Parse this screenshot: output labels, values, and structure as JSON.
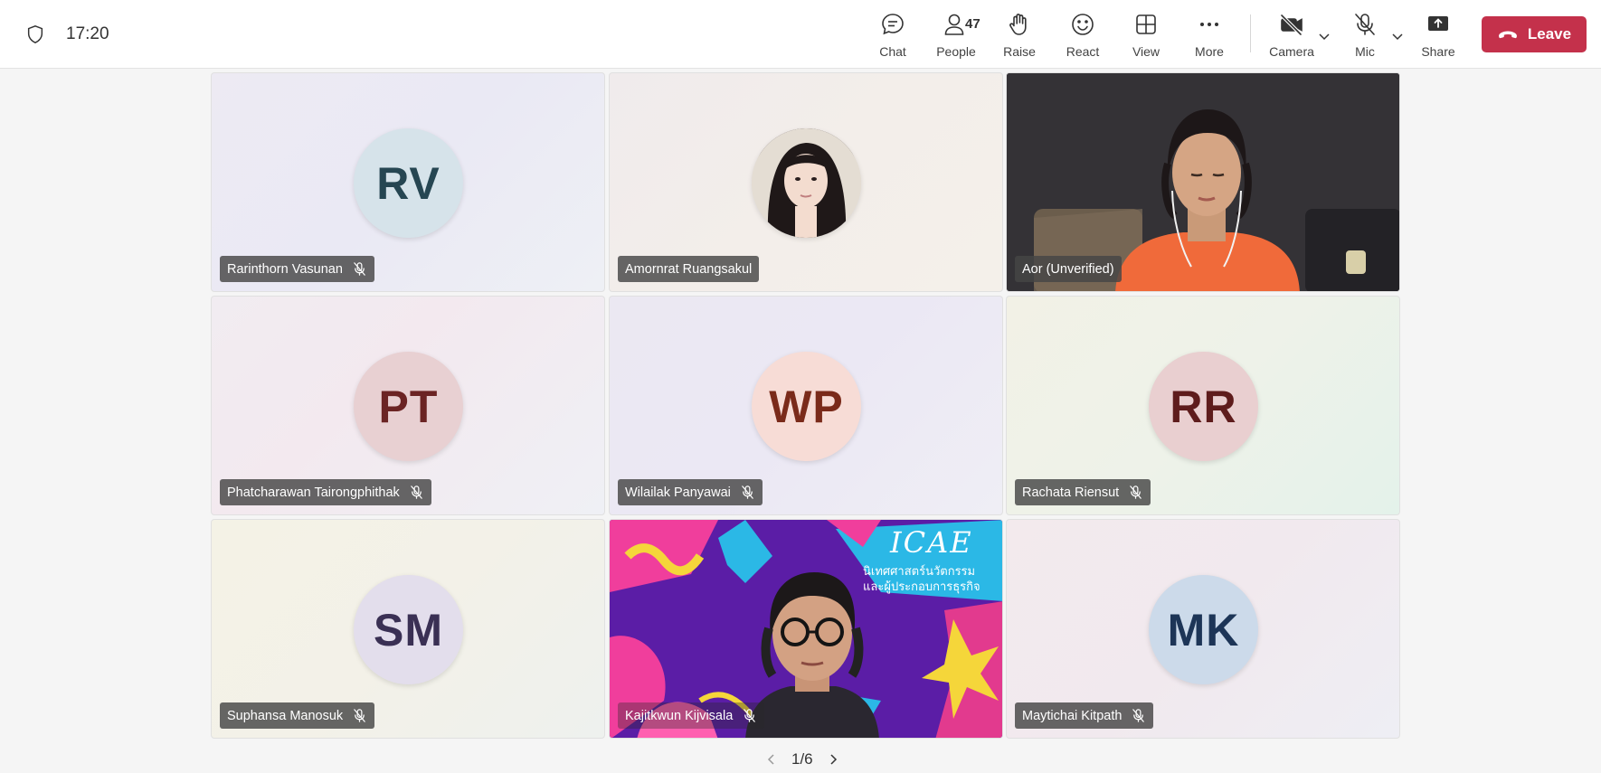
{
  "header": {
    "time": "17:20",
    "buttons": {
      "chat": "Chat",
      "people": "People",
      "people_count": "47",
      "raise": "Raise",
      "react": "React",
      "view": "View",
      "more": "More",
      "camera": "Camera",
      "mic": "Mic",
      "share": "Share",
      "leave": "Leave"
    }
  },
  "participants": [
    {
      "name": "Rarinthorn Vasunan",
      "initials": "RV",
      "muted": true
    },
    {
      "name": "Amornrat Ruangsakul",
      "initials": "",
      "muted": false
    },
    {
      "name": "Aor (Unverified)",
      "initials": "",
      "muted": false
    },
    {
      "name": "Phatcharawan Tairongphithak",
      "initials": "PT",
      "muted": true
    },
    {
      "name": "Wilailak Panyawai",
      "initials": "WP",
      "muted": true
    },
    {
      "name": "Rachata Riensut",
      "initials": "RR",
      "muted": true
    },
    {
      "name": "Suphansa Manosuk",
      "initials": "SM",
      "muted": true
    },
    {
      "name": "Kajitkwun Kijvisala",
      "initials": "",
      "muted": true
    },
    {
      "name": "Maytichai Kitpath",
      "initials": "MK",
      "muted": true
    }
  ],
  "video_overlay": {
    "title": "ICAE",
    "line1": "นิเทศศาสตร์นวัตกรรม",
    "line2": "และผู้ประกอบการธุรกิจ"
  },
  "pagination": {
    "label": "1/6"
  },
  "colors": {
    "leave": "#c4314b",
    "accent": "#5b5fc7"
  }
}
